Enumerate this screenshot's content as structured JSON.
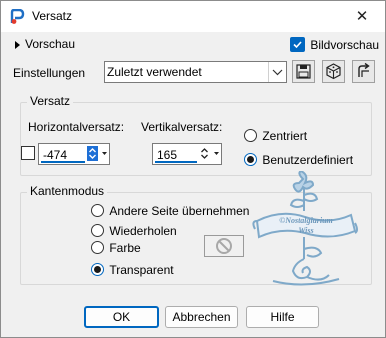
{
  "window": {
    "title": "Versatz",
    "close_glyph": "✕"
  },
  "header": {
    "preview_label": "Vorschau",
    "preview_icon": "triangle-right-icon",
    "image_preview_label": "Bildvorschau",
    "image_preview_checked": true
  },
  "settings": {
    "label": "Einstellungen",
    "value": "Zuletzt verwendet",
    "buttons": [
      "save-preset-icon",
      "preset-options-icon",
      "reset-icon"
    ]
  },
  "offset_group": {
    "title": "Versatz",
    "horizontal_label": "Horizontalversatz:",
    "horizontal_value": "-474",
    "vertical_label": "Vertikalversatz:",
    "vertical_value": "165",
    "options": [
      {
        "label": "Zentriert",
        "selected": false
      },
      {
        "label": "Benutzerdefiniert",
        "selected": true
      }
    ]
  },
  "edge_group": {
    "title": "Kantenmodus",
    "options": [
      {
        "label": "Andere Seite übernehmen",
        "selected": false
      },
      {
        "label": "Wiederholen",
        "selected": false
      },
      {
        "label": "Farbe",
        "selected": false
      },
      {
        "label": "Transparent",
        "selected": true
      }
    ],
    "color_swatch_icon": "no-color-icon"
  },
  "watermark": {
    "text_line1": "©Nostalgiarium",
    "text_line2": "Wiss"
  },
  "footer": {
    "ok": "OK",
    "cancel": "Abbrechen",
    "help": "Hilfe"
  },
  "colors": {
    "accent": "#0067c0",
    "window_bg": "#f0f0f0",
    "watermark": "#7fa9c9"
  }
}
